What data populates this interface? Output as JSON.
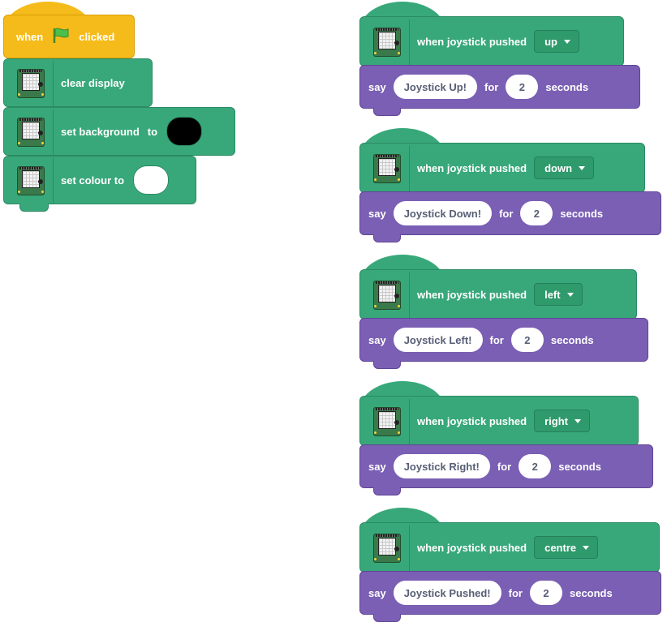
{
  "left_script": {
    "hat": {
      "when": "when",
      "clicked": "clicked"
    },
    "clear": "clear display",
    "set_bg": {
      "label": "set background",
      "to": "to",
      "color": "#000000"
    },
    "set_colour": {
      "label": "set colour to",
      "color": "#ffffff"
    }
  },
  "handlers": [
    {
      "when": "when joystick pushed",
      "direction": "up",
      "say": "say",
      "message": "Joystick Up!",
      "for": "for",
      "secs": "2",
      "seconds": "seconds"
    },
    {
      "when": "when joystick pushed",
      "direction": "down",
      "say": "say",
      "message": "Joystick Down!",
      "for": "for",
      "secs": "2",
      "seconds": "seconds"
    },
    {
      "when": "when joystick pushed",
      "direction": "left",
      "say": "say",
      "message": "Joystick Left!",
      "for": "for",
      "secs": "2",
      "seconds": "seconds"
    },
    {
      "when": "when joystick pushed",
      "direction": "right",
      "say": "say",
      "message": "Joystick Right!",
      "for": "for",
      "secs": "2",
      "seconds": "seconds"
    },
    {
      "when": "when joystick pushed",
      "direction": "centre",
      "say": "say",
      "message": "Joystick Pushed!",
      "for": "for",
      "secs": "2",
      "seconds": "seconds"
    }
  ],
  "colors": {
    "control": "#f5bb1a",
    "extension": "#38a87a",
    "looks": "#7a5fb4"
  },
  "icons": {
    "flag": "green-flag-icon",
    "extension": "sense-hat-icon",
    "dropdown": "caret-down-icon"
  }
}
